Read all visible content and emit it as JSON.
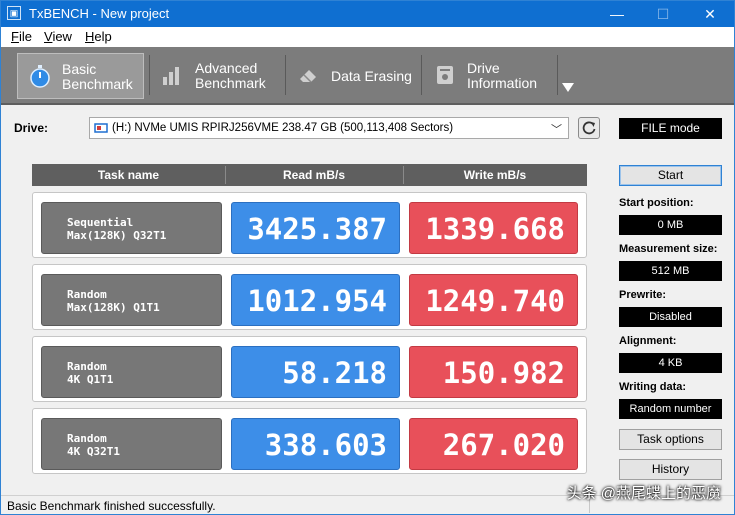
{
  "window": {
    "title": "TxBENCH - New project",
    "min": "—",
    "max": "☐",
    "close": "✕"
  },
  "menu": [
    {
      "label": "File",
      "key": "F",
      "rest": "ile"
    },
    {
      "label": "View",
      "key": "V",
      "rest": "iew"
    },
    {
      "label": "Help",
      "key": "H",
      "rest": "elp"
    }
  ],
  "tabs": [
    {
      "label": "Basic\nBenchmark",
      "icon": "stopwatch-icon",
      "active": true
    },
    {
      "label": "Advanced\nBenchmark",
      "icon": "bar-chart-icon",
      "active": false
    },
    {
      "label": "Data Erasing",
      "icon": "eraser-icon",
      "active": false
    },
    {
      "label": "Drive\nInformation",
      "icon": "drive-info-icon",
      "active": false
    }
  ],
  "drive": {
    "label": "Drive:",
    "selected": "(H:) NVMe UMIS RPIRJ256VME  238.47 GB (500,113,408 Sectors)"
  },
  "mode": "FILE mode",
  "table": {
    "headers": [
      "Task name",
      "Read mB/s",
      "Write mB/s"
    ],
    "rows": [
      {
        "task_line1": "Sequential",
        "task_line2": "Max(128K) Q32T1",
        "read": "3425.387",
        "write": "1339.668"
      },
      {
        "task_line1": "Random",
        "task_line2": "Max(128K) Q1T1",
        "read": "1012.954",
        "write": "1249.740"
      },
      {
        "task_line1": "Random",
        "task_line2": "4K Q1T1",
        "read": "58.218",
        "write": "150.982"
      },
      {
        "task_line1": "Random",
        "task_line2": "4K Q32T1",
        "read": "338.603",
        "write": "267.020"
      }
    ]
  },
  "side": {
    "start_button": "Start",
    "start_position_label": "Start position:",
    "start_position_value": "0 MB",
    "measurement_size_label": "Measurement size:",
    "measurement_size_value": "512 MB",
    "prewrite_label": "Prewrite:",
    "prewrite_value": "Disabled",
    "alignment_label": "Alignment:",
    "alignment_value": "4 KB",
    "writing_data_label": "Writing data:",
    "writing_data_value": "Random number",
    "task_options_button": "Task options",
    "history_button": "History"
  },
  "status": "Basic Benchmark finished successfully.",
  "watermark": "头条 @燕尾蝶上的恶魔",
  "colors": {
    "read": "#3d8ee8",
    "write": "#e8505a",
    "titlebar": "#0f6fd1"
  }
}
